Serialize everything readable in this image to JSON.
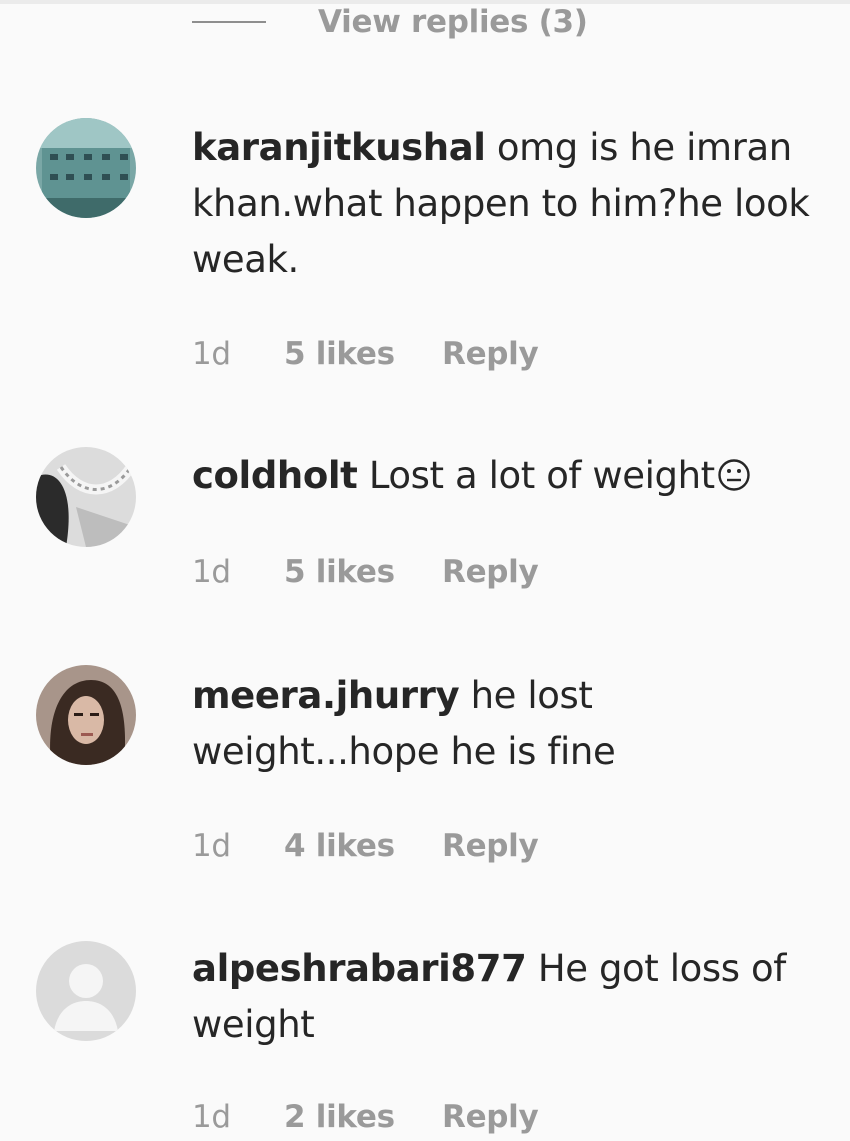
{
  "view_replies": {
    "label": "View replies (3)"
  },
  "comments": [
    {
      "username": "karanjitkushal",
      "text": "omg is he imran khan.what happen to him?he look weak.",
      "time": "1d",
      "likes": "5 likes",
      "reply": "Reply"
    },
    {
      "username": "coldholt",
      "text": "Lost a lot of weight",
      "emoji": "neutral-face-icon",
      "time": "1d",
      "likes": "5 likes",
      "reply": "Reply"
    },
    {
      "username": "meera.jhurry",
      "text": "he lost weight...hope he is fine",
      "time": "1d",
      "likes": "4 likes",
      "reply": "Reply"
    },
    {
      "username": "alpeshrabari877",
      "text": "He got loss of weight",
      "time": "1d",
      "likes": "2 likes",
      "reply": "Reply"
    }
  ],
  "colors": {
    "text": "#262626",
    "muted": "#9a9a9a",
    "background": "#fafafa"
  }
}
